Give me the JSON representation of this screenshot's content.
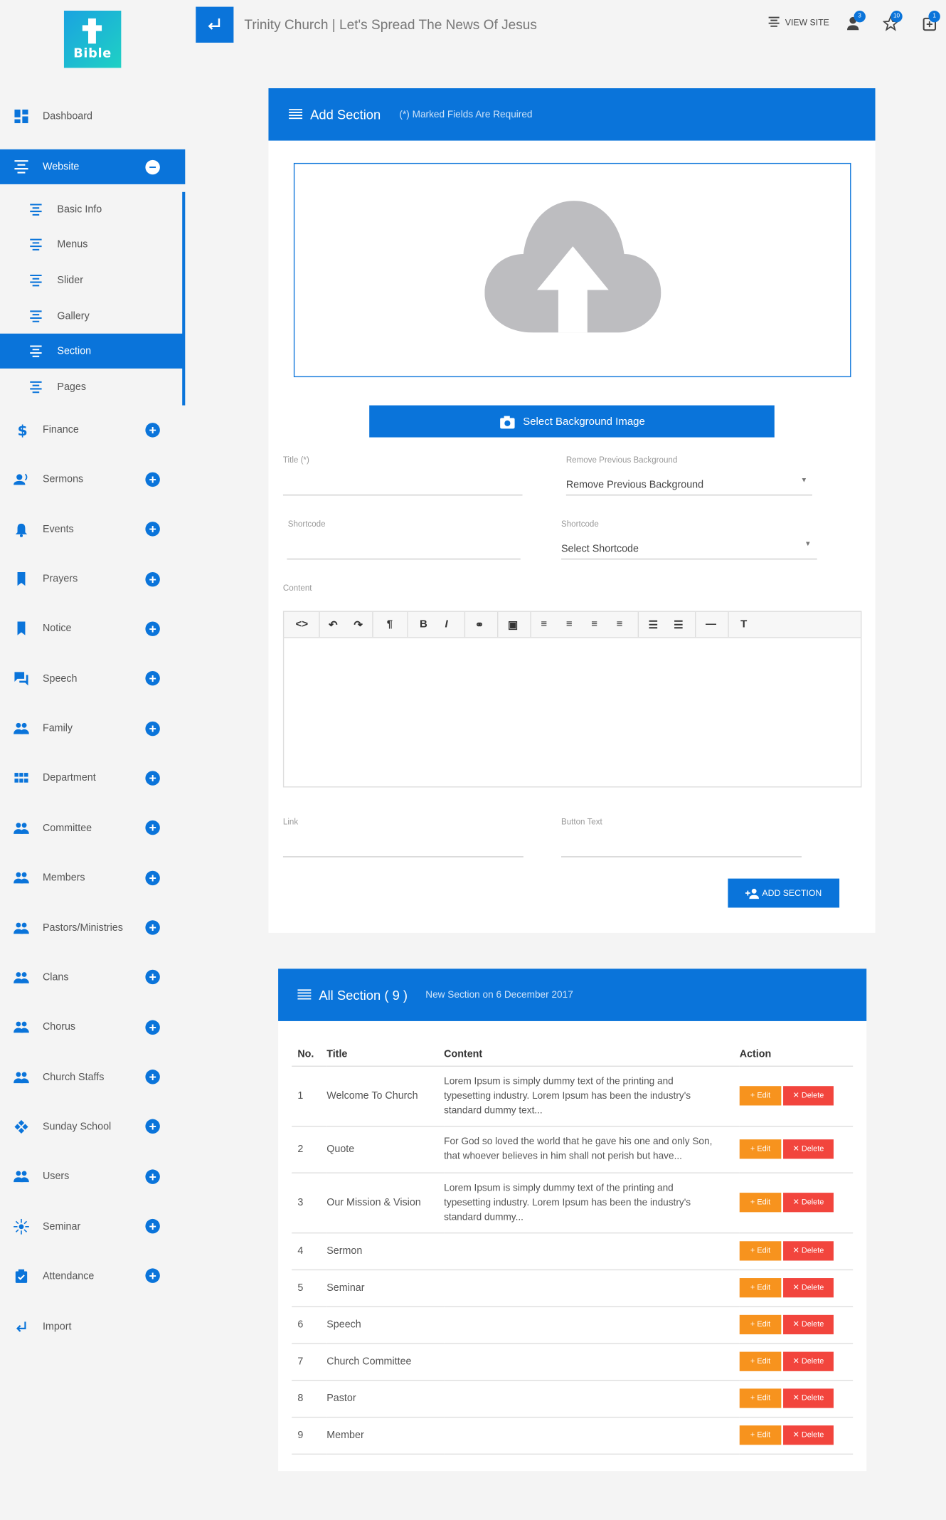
{
  "app": {
    "logo_text": "Bible",
    "title": "Trinity Church | Let's Spread The News Of Jesus"
  },
  "topbar": {
    "view_site": "VIEW SITE",
    "badges": [
      "3",
      "10",
      "1"
    ]
  },
  "sidebar": {
    "dashboard": "Dashboard",
    "website": "Website",
    "website_sub": [
      "Basic Info",
      "Menus",
      "Slider",
      "Gallery",
      "Section",
      "Pages"
    ],
    "items": [
      "Finance",
      "Sermons",
      "Events",
      "Prayers",
      "Notice",
      "Speech",
      "Family",
      "Department",
      "Committee",
      "Members",
      "Pastors/Ministries",
      "Clans",
      "Chorus",
      "Church Staffs",
      "Sunday School",
      "Users",
      "Seminar",
      "Attendance"
    ],
    "import": "Import"
  },
  "add_section": {
    "title": "Add Section",
    "subtitle": "(*) Marked Fields Are Required",
    "select_bg_button": "Select Background Image",
    "title_label": "Title (*)",
    "remove_bg_label": "Remove Previous Background",
    "remove_bg_value": "Remove Previous Background",
    "shortcode_label": "Shortcode",
    "shortcode_select_label": "Shortcode",
    "shortcode_select_value": "Select Shortcode",
    "content_label": "Content",
    "link_label": "Link",
    "button_text_label": "Button Text",
    "submit": "ADD SECTION"
  },
  "all_section": {
    "title": "All Section ( 9 )",
    "subtitle": "New Section on 6 December 2017",
    "columns": [
      "No.",
      "Title",
      "Content",
      "Action"
    ],
    "edit_label": "Edit",
    "delete_label": "Delete",
    "rows": [
      {
        "no": "1",
        "title": "Welcome To Church",
        "content": "Lorem Ipsum is simply dummy text of the printing and typesetting industry. Lorem Ipsum has been the industry's standard dummy text..."
      },
      {
        "no": "2",
        "title": "Quote",
        "content": "For God so loved the world that he gave his one and only Son, that whoever believes in him shall not perish but have..."
      },
      {
        "no": "3",
        "title": "Our Mission & Vision",
        "content": "Lorem Ipsum is simply dummy text of the printing and typesetting industry. Lorem Ipsum has been the industry's standard dummy..."
      },
      {
        "no": "4",
        "title": "Sermon",
        "content": ""
      },
      {
        "no": "5",
        "title": "Seminar",
        "content": ""
      },
      {
        "no": "6",
        "title": "Speech",
        "content": ""
      },
      {
        "no": "7",
        "title": "Church Committee",
        "content": ""
      },
      {
        "no": "8",
        "title": "Pastor",
        "content": ""
      },
      {
        "no": "9",
        "title": "Member",
        "content": ""
      }
    ]
  },
  "colors": {
    "primary": "#0a74da",
    "edit": "#f7931e",
    "delete": "#f2453d"
  }
}
